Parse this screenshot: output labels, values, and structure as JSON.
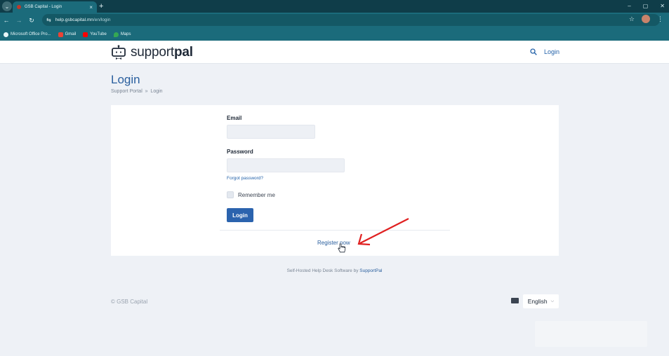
{
  "browser": {
    "tab_title": "GSB Capital - Login",
    "tab_close": "×",
    "new_tab": "+",
    "url_domain": "help.gsbcapital.mn",
    "url_path": "/en/login",
    "window_controls": [
      "–",
      "▢",
      "✕"
    ],
    "bookmarks": [
      {
        "label": "Microsoft Office Pro...",
        "color": "#e8f6f8"
      },
      {
        "label": "Gmail",
        "color": "#ea4335"
      },
      {
        "label": "YouTube",
        "color": "#ff0000"
      },
      {
        "label": "Maps",
        "color": "#34a853"
      }
    ],
    "profile_initial": "a"
  },
  "header": {
    "logo_light": "support",
    "logo_bold": "pal",
    "login_link": "Login"
  },
  "page": {
    "title": "Login",
    "breadcrumb": "Support Portal  »  Login"
  },
  "form": {
    "email_label": "Email",
    "email_value": "",
    "password_label": "Password",
    "password_value": "",
    "forgot_label": "Forgot password?",
    "remember_label": "Remember me",
    "login_button": "Login",
    "register_label": "Register now"
  },
  "footer": {
    "powered_prefix": "Self-Hosted Help Desk Software by ",
    "powered_brand": "SupportPal",
    "copyright": "© GSB Capital",
    "language": "English"
  },
  "colors": {
    "accent": "#2b63ae",
    "browser": "#1b6b7b",
    "annotation_arrow": "#e02020"
  }
}
